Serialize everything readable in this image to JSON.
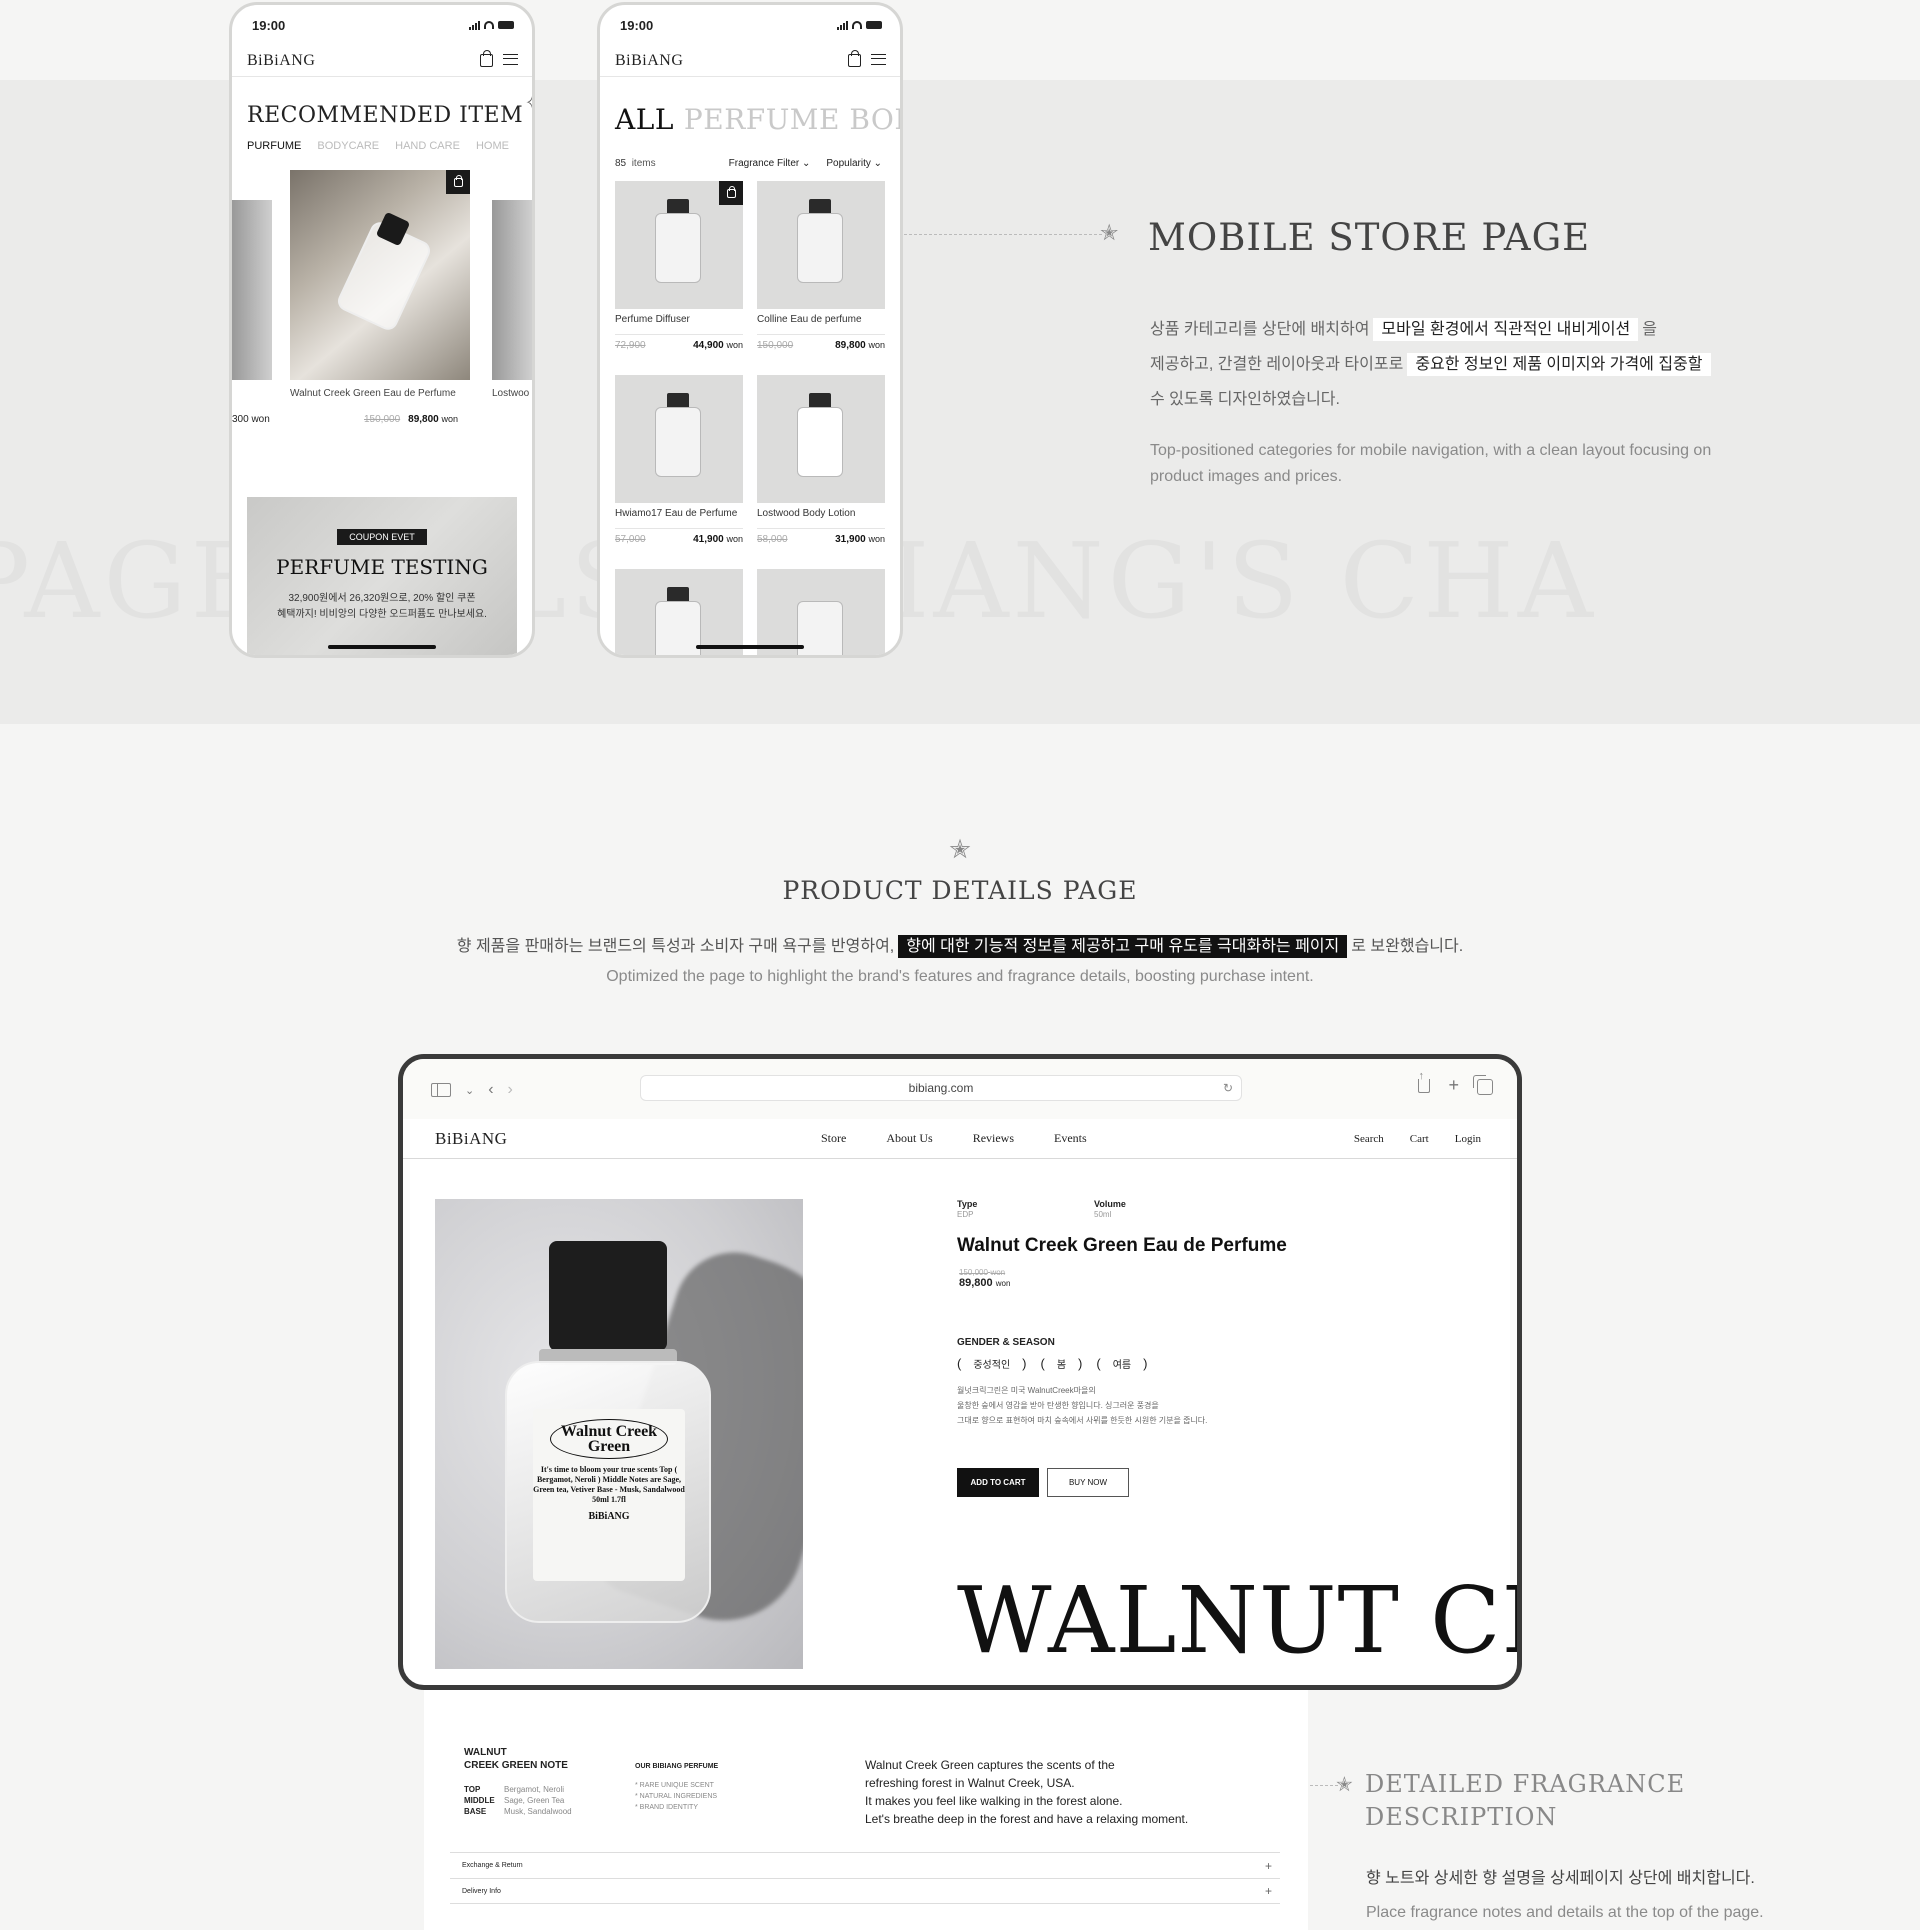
{
  "background_text": "PAGE          T       ALS BIBIANG'S CHA",
  "phone_status_time": "19:00",
  "brand": "BiBiANG",
  "phone1": {
    "title": "RECOMMENDED ITEM",
    "tabs": [
      "PURFUME",
      "BODYCARE",
      "HAND CARE",
      "HOME"
    ],
    "featured": {
      "name": "Walnut Creek Green Eau de Perfume",
      "old_price": "150,000",
      "price": "89,800",
      "unit": "won"
    },
    "side_price": "300 won",
    "side_name": "Lostwoo",
    "coupon": {
      "tag": "COUPON EVET",
      "title": "PERFUME TESTING",
      "desc1": "32,900원에서 26,320원으로, 20% 할인 쿠폰",
      "desc2": "혜택까지! 비비앙의 다양한 오드퍼퓸도 만나보세요."
    }
  },
  "phone2": {
    "title_active": "ALL",
    "title_rest": "PERFUME  BOD",
    "count": "85",
    "count_label": "items",
    "filter_label": "Fragrance Filter ⌄",
    "sort_label": "Popularity ⌄",
    "products": [
      {
        "name": "Perfume Diffuser",
        "old": "72,900",
        "price": "44,900",
        "unit": "won"
      },
      {
        "name": "Colline Eau de perfume",
        "old": "150,000",
        "price": "89,800",
        "unit": "won"
      },
      {
        "name": "Hwiamo17 Eau de Perfume",
        "old": "57,000",
        "price": "41,900",
        "unit": "won"
      },
      {
        "name": "Lostwood Body Lotion",
        "old": "58,000",
        "price": "31,900",
        "unit": "won"
      }
    ]
  },
  "mobile_section": {
    "title": "MOBILE STORE PAGE",
    "kr_1a": "상품 카테고리를 상단에 배치하여",
    "kr_1b": "모바일 환경에서 직관적인 내비게이션",
    "kr_1c": "을",
    "kr_2a": "제공하고, 간결한 레이아웃과 타이포로",
    "kr_2b": "중요한 정보인  제품 이미지와 가격에 집중할",
    "kr_3": "수 있도록 디자인하였습니다.",
    "en": "Top-positioned categories for mobile navigation, with a clean layout focusing on product images and prices."
  },
  "details_section": {
    "title": "PRODUCT DETAILS PAGE",
    "kr_a": "향 제품을 판매하는 브랜드의 특성과 소비자 구매 욕구를 반영하여,",
    "kr_b": "향에 대한 기능적 정보를 제공하고 구매 유도를 극대화하는 페이지",
    "kr_c": "로 보완했습니다.",
    "en": "Optimized the page to highlight the brand's features and fragrance details, boosting purchase intent."
  },
  "browser": {
    "url": "bibiang.com",
    "nav": [
      "Store",
      "About Us",
      "Reviews",
      "Events"
    ],
    "util": [
      "Search",
      "Cart",
      "Login"
    ]
  },
  "product": {
    "type_label": "Type",
    "type_value": "EDP",
    "volume_label": "Volume",
    "volume_value": "50ml",
    "name": "Walnut Creek Green Eau de Perfume",
    "old_price": "150,000",
    "price": "89,800",
    "unit": "won",
    "gs_title": "GENDER & SEASON",
    "chips": [
      "중성적인",
      "봄",
      "여름"
    ],
    "desc1": "월넛크릭그린은 미국 WalnutCreek마을의",
    "desc2": "울창한 숲에서 영감을 받아 탄생한 향입니다. 싱그러운 풍경을",
    "desc3": "그대로 향으로 표현하여 마치 숲속에서 사뮈를 한듯한 시원한 기분을 줍니다.",
    "add_to_cart": "ADD TO CART",
    "buy_now": "BUY NOW",
    "big_name": "WALNUT CR",
    "label_line1": "Walnut Creek",
    "label_line2": "Green",
    "label_text": "It's time to bloom your true scents Top ( Bergamot, Neroli ) Middle Notes are Sage, Green tea, Vetiver Base - Musk, Sandalwood 50ml 1.7fl",
    "label_brand": "BiBiANG"
  },
  "notes": {
    "head1": "WALNUT",
    "head2": "CREEK GREEN NOTE",
    "rows": [
      {
        "k": "TOP",
        "v": "Bergamot, Neroli"
      },
      {
        "k": "MIDDLE",
        "v": "Sage, Green Tea"
      },
      {
        "k": "BASE",
        "v": "Musk, Sandalwood"
      }
    ],
    "ours_title": "OUR BIBIANG PERFUME",
    "ours": [
      "* RARE UNIQUE SCENT",
      "* NATURAL INGREDIENS",
      "* BRAND IDENTITY"
    ],
    "story1": "Walnut Creek Green captures the scents of the",
    "story2": "refreshing forest in Walnut Creek, USA.",
    "story3": "It makes you feel like walking in the forest alone.",
    "story4": "Let's breathe deep in the forest and have a relaxing moment.",
    "acc1": "Exchange & Return",
    "acc2": "Delivery Info"
  },
  "fragrance_section": {
    "title1": "DETAILED FRAGRANCE",
    "title2": "DESCRIPTION",
    "kr": "향 노트와 상세한 향 설명을 상세페이지 상단에 배치합니다.",
    "en": "Place fragrance notes and details at the top of the page."
  }
}
